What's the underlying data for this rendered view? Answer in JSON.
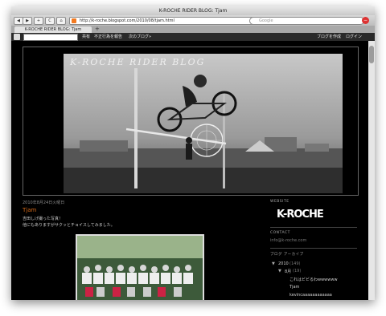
{
  "window": {
    "title": "K-ROCHE RIDER BLOG: Tjam"
  },
  "toolbar": {
    "back": "◀",
    "forward": "▶",
    "share": "+",
    "reload": "C",
    "home": "⌂",
    "url": "http://k-roche.blogspot.com/2010/08/tjam.html",
    "search_placeholder": "Google",
    "stop": "−"
  },
  "tabs": [
    {
      "label": "K-ROCHE RIDER BLOG: Tjam"
    }
  ],
  "tab_add": "+",
  "blogger_bar": {
    "search_button": "Q",
    "links": [
      "共有",
      "不正行為を報告",
      "次のブログ»"
    ],
    "right_links": [
      "ブログを作成",
      "ログイン"
    ]
  },
  "header": {
    "title": "K-ROCHE RIDER BLOG"
  },
  "post": {
    "date": "2010年8月24日火曜日",
    "title": "Tjam",
    "body_lines": [
      "吉田しげ撮った写真！",
      "他にもありますがサクッとチョイスしてみました。"
    ]
  },
  "sidebar": {
    "website_heading": "WEBSITE",
    "logo": "K-ROCHE",
    "contact_heading": "CONTACT",
    "contact_email": "info@k-roche.com",
    "archive_heading": "ブログ アーカイブ",
    "archive_year": "2010",
    "archive_year_count": "(149)",
    "archive_month": "8月",
    "archive_month_count": "(19)",
    "posts": [
      "これはビビるわwwwwww",
      "Tjam",
      "kevincaaaaaaaaaaaa"
    ],
    "expand_icon": "▼"
  }
}
